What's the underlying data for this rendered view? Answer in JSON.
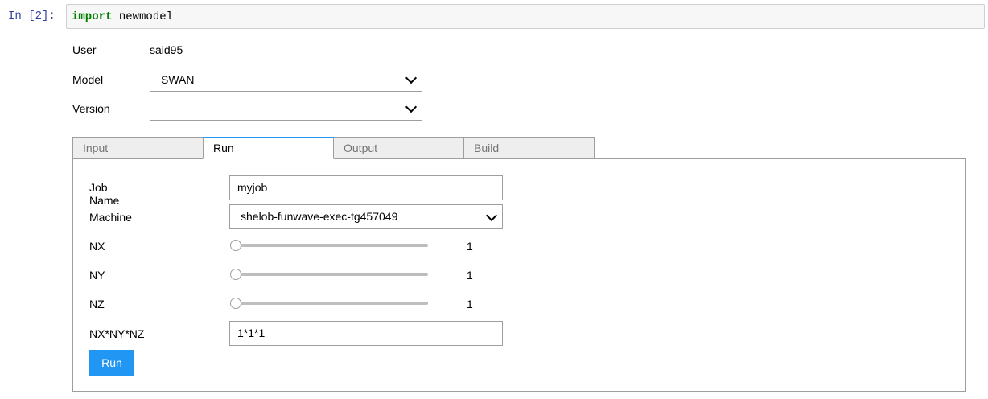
{
  "cell": {
    "prompt": "In [2]:",
    "code_keyword": "import",
    "code_module": "newmodel"
  },
  "header": {
    "user_label": "User",
    "user_value": "said95",
    "model_label": "Model",
    "model_value": "SWAN",
    "version_label": "Version",
    "version_value": ""
  },
  "tabs": [
    {
      "label": "Input",
      "active": false
    },
    {
      "label": "Run",
      "active": true
    },
    {
      "label": "Output",
      "active": false
    },
    {
      "label": "Build",
      "active": false
    }
  ],
  "run_panel": {
    "job_name_label": "Job Name",
    "job_name_value": "myjob",
    "machine_label": "Machine",
    "machine_value": "shelob-funwave-exec-tg457049",
    "nx_label": "NX",
    "nx_value": "1",
    "ny_label": "NY",
    "ny_value": "1",
    "nz_label": "NZ",
    "nz_value": "1",
    "product_label": "NX*NY*NZ",
    "product_value": "1*1*1",
    "run_button_label": "Run"
  },
  "colors": {
    "accent": "#2196f3",
    "keyword": "#008000",
    "prompt": "#303f9f"
  },
  "icons": [
    "chevron-down-icon"
  ]
}
